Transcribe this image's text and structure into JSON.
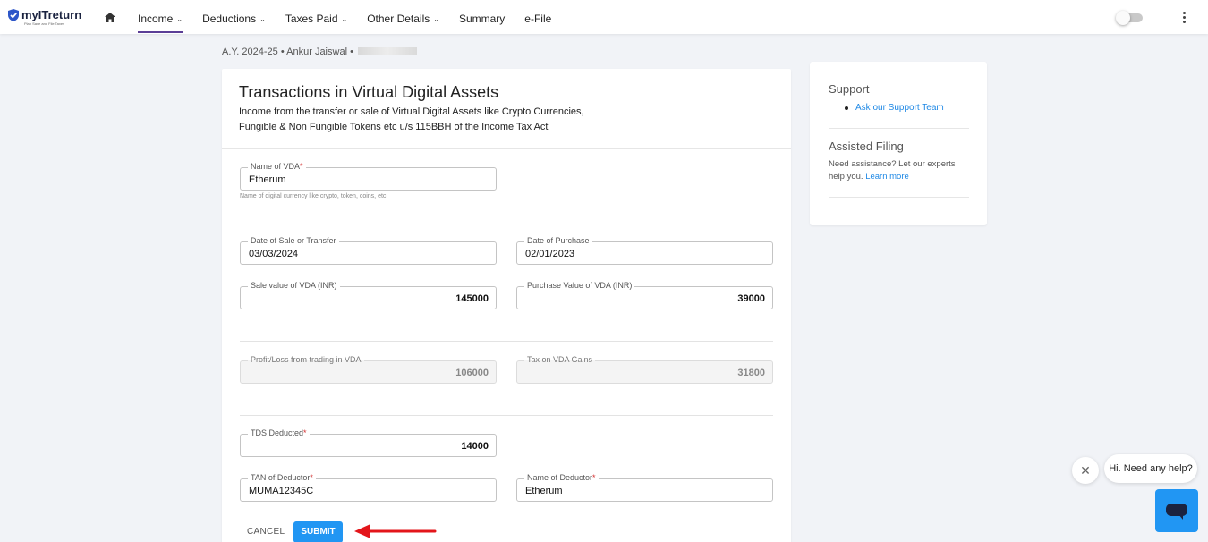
{
  "brand": {
    "name": "myITreturn",
    "tagline": "Plan Save and File Taxes"
  },
  "nav": {
    "items": [
      {
        "label": "Income",
        "has_dropdown": true,
        "active": true
      },
      {
        "label": "Deductions",
        "has_dropdown": true
      },
      {
        "label": "Taxes Paid",
        "has_dropdown": true
      },
      {
        "label": "Other Details",
        "has_dropdown": true
      },
      {
        "label": "Summary",
        "has_dropdown": false
      },
      {
        "label": "e-File",
        "has_dropdown": false
      }
    ]
  },
  "meta": {
    "text": "A.Y. 2024-25 • Ankur Jaiswal •"
  },
  "card": {
    "title": "Transactions in Virtual Digital Assets",
    "subtitle": "Income from the transfer or sale of Virtual Digital Assets like Crypto Currencies, Fungible & Non Fungible Tokens etc u/s 115BBH of the Income Tax Act"
  },
  "form": {
    "vda_name": {
      "label": "Name of VDA",
      "required": true,
      "value": "Etherum",
      "helper": "Name of digital currency like crypto, token, coins, etc."
    },
    "sale_date": {
      "label": "Date of Sale or Transfer",
      "value": "03/03/2024"
    },
    "purchase_date": {
      "label": "Date of Purchase",
      "value": "02/01/2023"
    },
    "sale_value": {
      "label": "Sale value of VDA (INR)",
      "value": "145000"
    },
    "purchase_value": {
      "label": "Purchase Value of VDA (INR)",
      "value": "39000"
    },
    "profit_loss": {
      "label": "Profit/Loss from trading in VDA",
      "value": "106000"
    },
    "tax_on_gains": {
      "label": "Tax on VDA Gains",
      "value": "31800"
    },
    "tds_deducted": {
      "label": "TDS Deducted",
      "required": true,
      "value": "14000"
    },
    "tan_deductor": {
      "label": "TAN of Deductor",
      "required": true,
      "value": "MUMA12345C"
    },
    "name_deductor": {
      "label": "Name of Deductor",
      "required": true,
      "value": "Etherum"
    },
    "cancel_label": "CANCEL",
    "submit_label": "SUBMIT"
  },
  "support": {
    "title": "Support",
    "link": "Ask our Support Team",
    "assisted_title": "Assisted Filing",
    "assisted_text": "Need assistance? Let our experts help you.",
    "learn_more": "Learn more"
  },
  "chat": {
    "close": "✕",
    "greeting": "Hi. Need any help?"
  },
  "colors": {
    "accent": "#2196f3",
    "nav_active": "#5b3e96",
    "link": "#1e88e5",
    "arrow": "#e3151a"
  }
}
